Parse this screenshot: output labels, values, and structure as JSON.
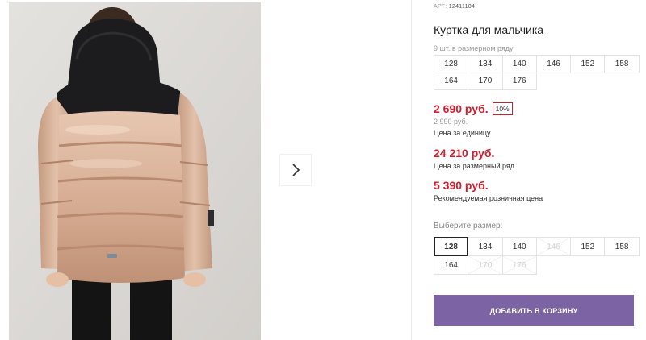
{
  "product": {
    "article_label": "АРТ:",
    "article_value": "12411104",
    "title": "Куртка для мальчика",
    "pack_note": "9 шт. в размерном ряду",
    "pack_sizes": [
      "128",
      "134",
      "140",
      "146",
      "152",
      "158",
      "164",
      "170",
      "176"
    ],
    "price": "2 690 руб.",
    "discount_badge": "10%",
    "old_price": "2 990 руб.",
    "price_caption": "Цена за единицу",
    "pack_price": "24 210 руб.",
    "pack_price_caption": "Цена за размерный ряд",
    "retail_price": "5 390 руб.",
    "retail_price_caption": "Рекомендуемая розничная цена"
  },
  "size_picker": {
    "label": "Выберите размер:",
    "selected": "128",
    "sizes": [
      {
        "label": "128",
        "available": true
      },
      {
        "label": "134",
        "available": true
      },
      {
        "label": "140",
        "available": true
      },
      {
        "label": "146",
        "available": false
      },
      {
        "label": "152",
        "available": true
      },
      {
        "label": "158",
        "available": true
      },
      {
        "label": "164",
        "available": true
      },
      {
        "label": "170",
        "available": false
      },
      {
        "label": "176",
        "available": false
      }
    ]
  },
  "cart_button_label": "ДОБАВИТЬ В КОРЗИНУ",
  "gallery": {
    "next_icon": "chevron-right-icon",
    "photo_subject": "jacket-back-view"
  },
  "colors": {
    "price_red": "#d01f2f",
    "button_purple": "#7c63a3",
    "jacket_beige": "#d9b39a",
    "jacket_black": "#1c1c1e"
  }
}
